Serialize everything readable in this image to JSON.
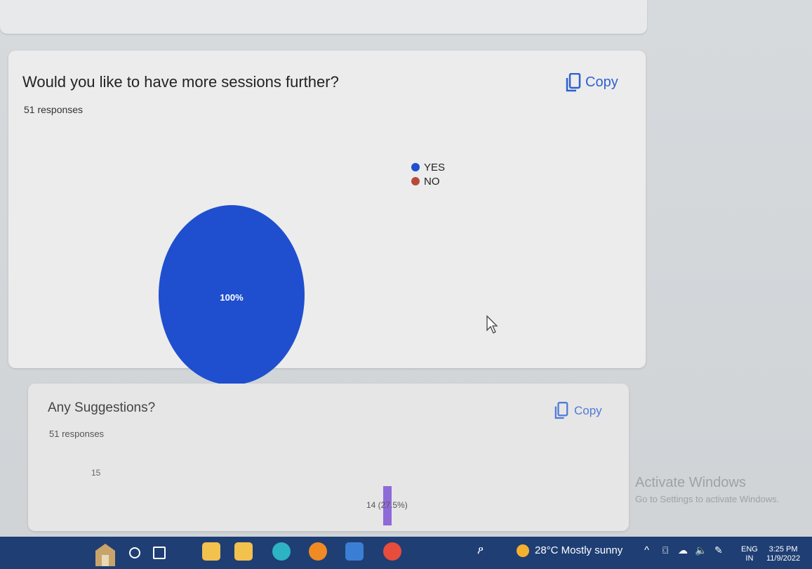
{
  "question1": {
    "title": "Would you like to have more sessions further?",
    "responses": "51 responses",
    "copy_label": "Copy",
    "pie_label": "100%",
    "legend": [
      {
        "label": "YES",
        "color": "#1f4fcf"
      },
      {
        "label": "NO",
        "color": "#b84a3a"
      }
    ]
  },
  "chart_data": {
    "type": "pie",
    "categories": [
      "YES",
      "NO"
    ],
    "values": [
      100,
      0
    ],
    "slice_labels": [
      "100%",
      ""
    ],
    "legend_position": "right"
  },
  "question2": {
    "title": "Any Suggestions?",
    "responses": "51 responses",
    "copy_label": "Copy",
    "axis_tick": "15",
    "bar_label": "14 (27.5%)",
    "bar_color": "#8e6ad8"
  },
  "watermark": {
    "line1": "Activate Windows",
    "line2": "Go to Settings to activate Windows."
  },
  "taskbar": {
    "apps": [
      {
        "icon": "search-icon",
        "color": "#ffffff"
      },
      {
        "icon": "task-view-icon",
        "color": "#ffffff"
      },
      {
        "icon": "file-explorer-icon",
        "color": "#f2c14e"
      },
      {
        "icon": "store-icon",
        "color": "#f2c14e"
      },
      {
        "icon": "edge-icon",
        "color": "#2db3c4"
      },
      {
        "icon": "firefox-icon",
        "color": "#f08a24"
      },
      {
        "icon": "mail-icon",
        "color": "#3a7fd5"
      },
      {
        "icon": "chrome-icon",
        "color": "#e74c3c"
      }
    ],
    "weather": "28°C  Mostly sunny",
    "language_top": "ENG",
    "language_bottom": "IN",
    "time": "3:25 PM",
    "date": "11/9/2022"
  }
}
